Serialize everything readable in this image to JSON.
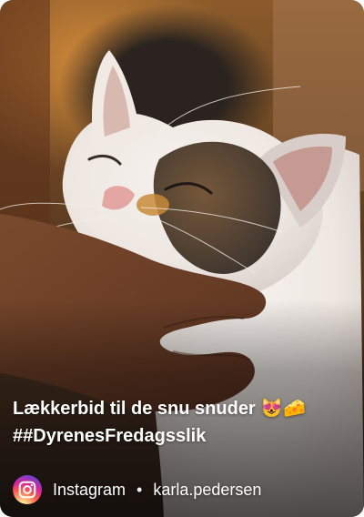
{
  "post": {
    "caption_line1": "Lækkerbid til de snu snuder 😻🧀",
    "caption_line2": "##DyrenesFredagsslik"
  },
  "footer": {
    "source": "Instagram",
    "separator": "•",
    "username": "karla.pedersen"
  },
  "icons": {
    "source_icon": "instagram-icon"
  },
  "colors": {
    "caption_text": "#ffffff"
  }
}
